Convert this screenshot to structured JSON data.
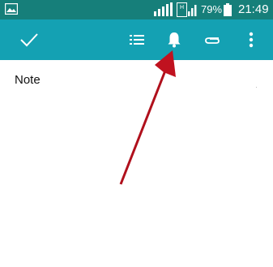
{
  "status_bar": {
    "battery_percent": "79%",
    "time": "21:49",
    "signal_1_label": "H",
    "signal_2_label": "H",
    "icons": [
      "gallery-icon",
      "signal-icon",
      "signal-h-icon",
      "battery-icon"
    ]
  },
  "toolbar": {
    "icons": [
      "checkmark-icon",
      "list-icon",
      "bell-icon",
      "paperclip-icon",
      "more-vert-icon"
    ]
  },
  "note": {
    "title": "Note"
  },
  "annotation": {
    "color": "#c0121f",
    "points_to": "bell-icon"
  },
  "colors": {
    "status_bar": "#167f7a",
    "toolbar": "#14a1b3"
  }
}
